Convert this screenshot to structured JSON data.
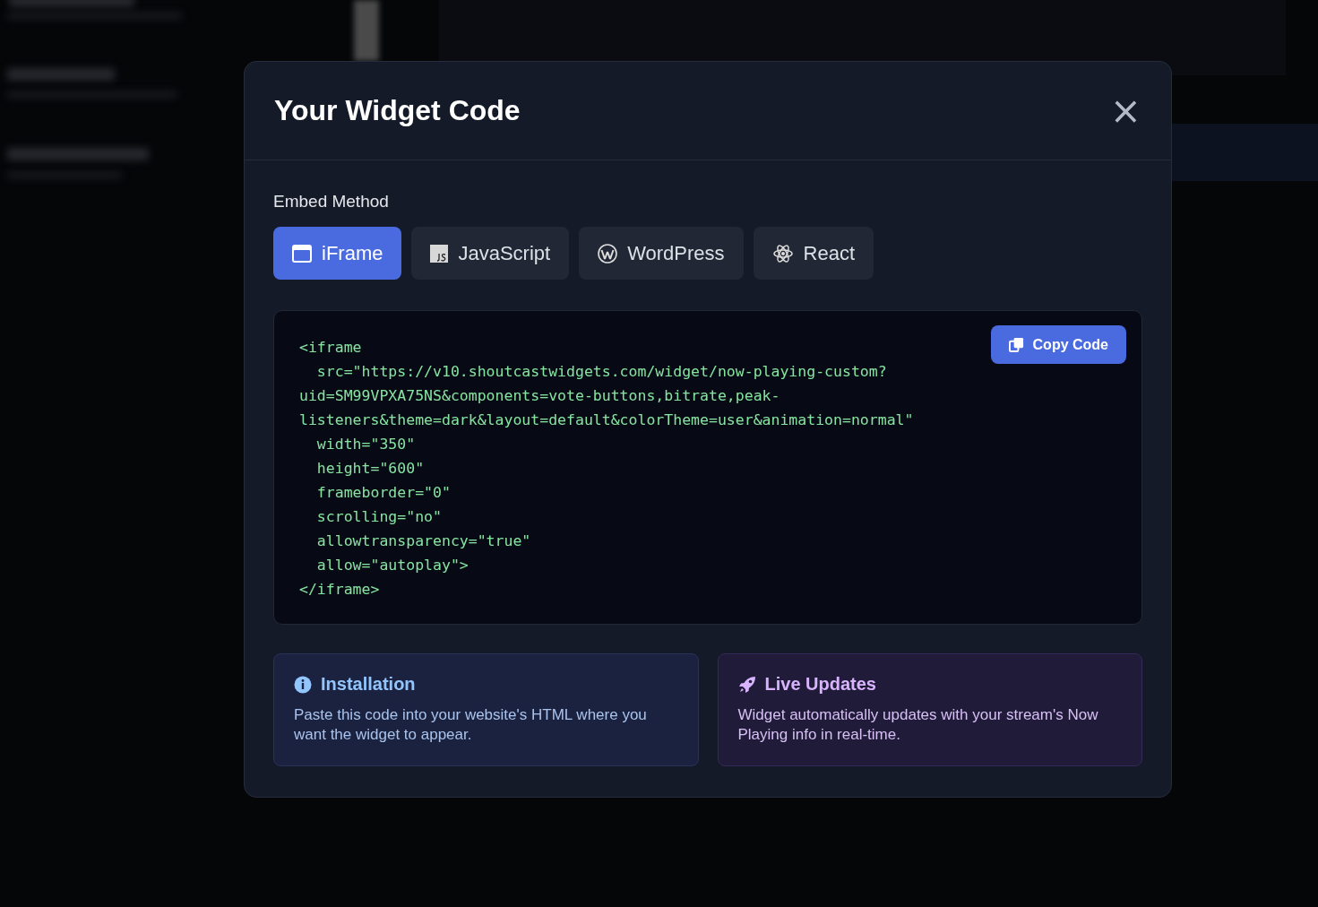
{
  "modal": {
    "title": "Your Widget Code",
    "close_icon": "×",
    "embed_label": "Embed Method",
    "tabs": [
      {
        "label": "iFrame",
        "kind": "window",
        "selected": true
      },
      {
        "label": "JavaScript",
        "kind": "js",
        "selected": false
      },
      {
        "label": "WordPress",
        "kind": "wordpress",
        "selected": false
      },
      {
        "label": "React",
        "kind": "react",
        "selected": false
      }
    ],
    "copy_button": "Copy Code",
    "code_lines": [
      "<iframe",
      "  src=\"https://v10.shoutcastwidgets.com/widget/now-playing-custom?",
      "uid=SM99VPXA75NS&components=vote-buttons,bitrate,peak-",
      "listeners&theme=dark&layout=default&colorTheme=user&animation=normal\"",
      "  width=\"350\"",
      "  height=\"600\"",
      "  frameborder=\"0\"",
      "  scrolling=\"no\"",
      "  allowtransparency=\"true\"",
      "  allow=\"autoplay\">",
      "</iframe>"
    ],
    "info_cards": [
      {
        "kind": "info",
        "title": "Installation",
        "text": "Paste this code into your website's HTML where you want the widget to appear."
      },
      {
        "kind": "rocket",
        "title": "Live Updates",
        "text": "Widget automatically updates with your stream's Now Playing info in real-time."
      }
    ]
  }
}
